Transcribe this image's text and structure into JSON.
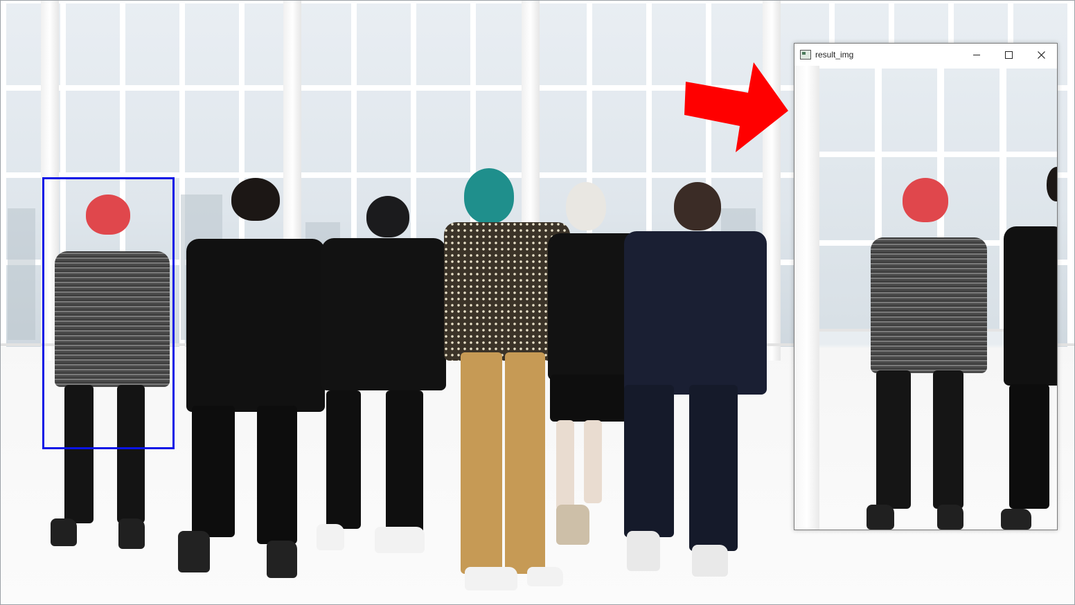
{
  "result_window": {
    "title": "result_img",
    "controls": [
      "minimize",
      "maximize",
      "close"
    ]
  },
  "overlays": {
    "detection_box_color": "#0a14e6",
    "arrow_color": "#ff0000"
  },
  "icons": {
    "app": "window-app-icon",
    "minimize": "minimize-icon",
    "maximize": "maximize-icon",
    "close": "close-icon"
  }
}
